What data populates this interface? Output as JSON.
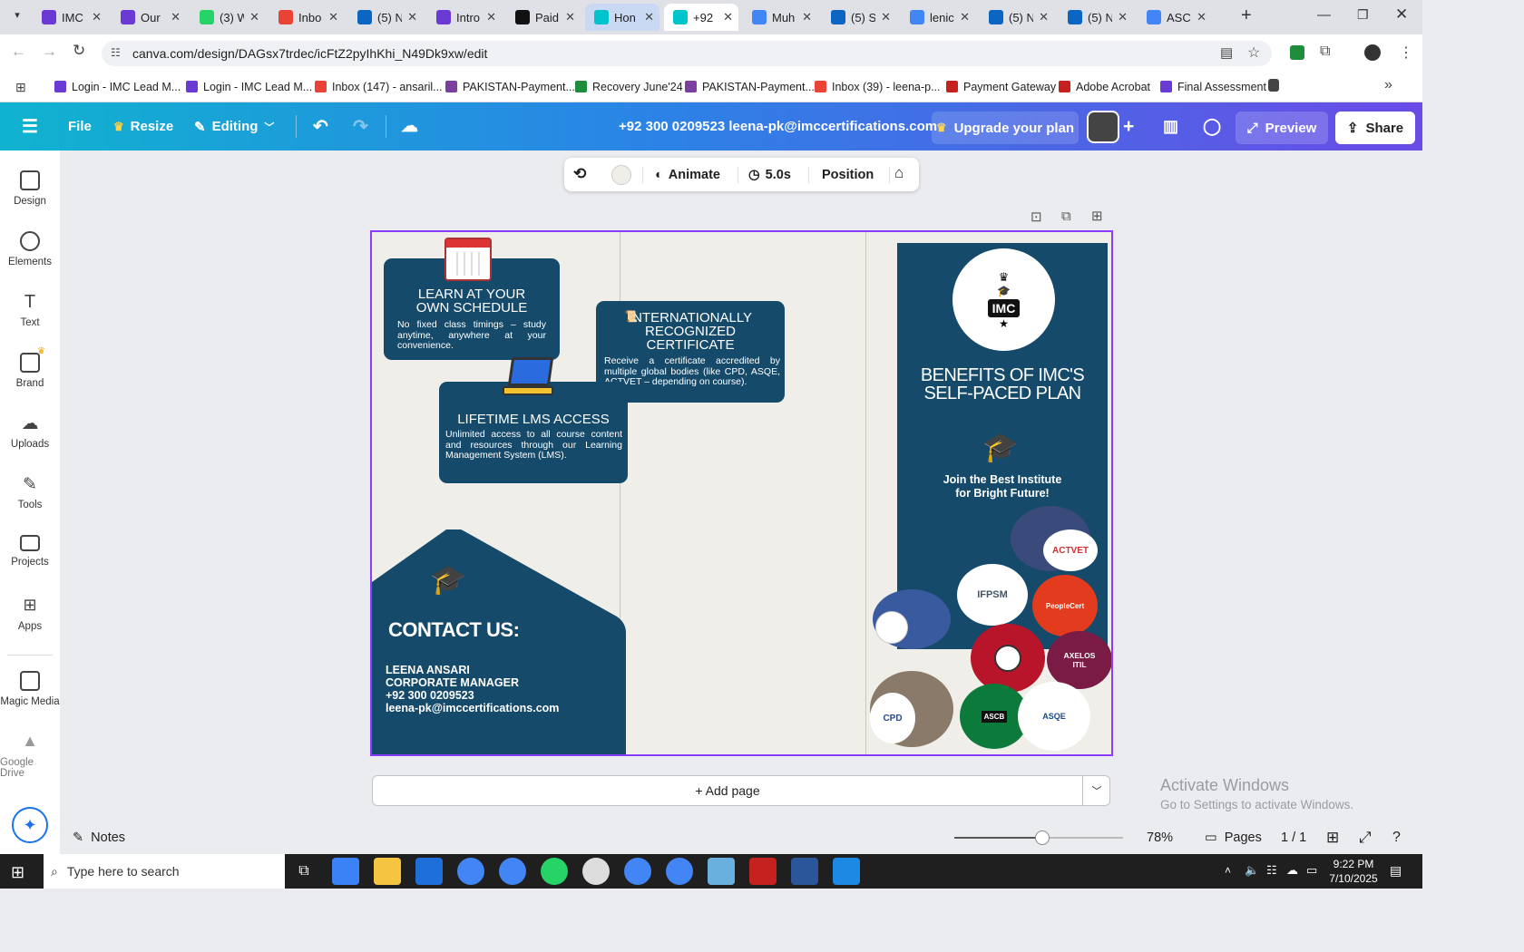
{
  "browser": {
    "tabs": [
      {
        "title": "IMC",
        "color": "#6b3ad4"
      },
      {
        "title": "Our",
        "color": "#6b3ad4"
      },
      {
        "title": "(3) W",
        "color": "#25d366"
      },
      {
        "title": "Inbo",
        "color": "#ea4335"
      },
      {
        "title": "(5) N",
        "color": "#0a66c2"
      },
      {
        "title": "Intro",
        "color": "#6b3ad4"
      },
      {
        "title": "Paid",
        "color": "#111111"
      },
      {
        "title": "Hon",
        "color": "#00c4cc"
      },
      {
        "title": "+92",
        "color": "#00c4cc"
      },
      {
        "title": "Muh",
        "color": "#4285f4"
      },
      {
        "title": "(5) S",
        "color": "#0a66c2"
      },
      {
        "title": "lenic",
        "color": "#4285f4"
      },
      {
        "title": "(5) N",
        "color": "#0a66c2"
      },
      {
        "title": "(5) N",
        "color": "#0a66c2"
      },
      {
        "title": "ASC",
        "color": "#4285f4"
      }
    ],
    "url": "canva.com/design/DAGsx7trdec/icFtZ2pyIhKhi_N49Dk9xw/edit",
    "bookmarks": [
      {
        "label": "Login - IMC Lead M...",
        "color": "#6b3ad4"
      },
      {
        "label": "Login - IMC Lead M...",
        "color": "#6b3ad4"
      },
      {
        "label": "Inbox (147) - ansaril...",
        "color": "#ea4335"
      },
      {
        "label": "PAKISTAN-Payment...",
        "color": "#7b3fa0"
      },
      {
        "label": "Recovery June'24",
        "color": "#1e8e3e"
      },
      {
        "label": "PAKISTAN-Payment...",
        "color": "#7b3fa0"
      },
      {
        "label": "Inbox (39) - leena-p...",
        "color": "#ea4335"
      },
      {
        "label": "Payment Gateway",
        "color": "#c5221f"
      },
      {
        "label": "Adobe Acrobat",
        "color": "#c5221f"
      },
      {
        "label": "Final Assessment",
        "color": "#6b3ad4"
      }
    ]
  },
  "header": {
    "file": "File",
    "resize": "Resize",
    "editing": "Editing",
    "title": "+92 300 0209523 leena-pk@imccertifications.com",
    "upgrade": "Upgrade your plan",
    "preview": "Preview",
    "share": "Share"
  },
  "sidebar": {
    "items": [
      "Design",
      "Elements",
      "Text",
      "Brand",
      "Uploads",
      "Tools",
      "Projects",
      "Apps",
      "Magic Media",
      "Google Drive"
    ]
  },
  "toolbar": {
    "animate": "Animate",
    "duration": "5.0s",
    "position": "Position"
  },
  "design": {
    "card1": {
      "title": "LEARN AT YOUR OWN SCHEDULE",
      "body": "No fixed class timings – study anytime, anywhere at your convenience."
    },
    "card2": {
      "title": "INTERNATIONALLY RECOGNIZED CERTIFICATE",
      "body": "Receive a certificate accredited by multiple global bodies (like CPD, ASQE, ACTVET – depending on course)."
    },
    "card3": {
      "title": "LIFETIME LMS ACCESS",
      "body": "Unlimited access to all course content and resources through our Learning Management System (LMS)."
    },
    "contact": {
      "title": "CONTACT US:",
      "name": "LEENA ANSARI",
      "role": "CORPORATE MANAGER",
      "phone": "+92 300 0209523",
      "email": "leena-pk@imccertifications.com"
    },
    "cover": {
      "logo_text": "IMC",
      "headline": "BENEFITS OF IMC'S SELF-PACED PLAN",
      "tagline": "Join the Best Institute for Bright Future!"
    },
    "badges": [
      "ACTVET",
      "IFPSM",
      "PeopleCert",
      "AXELOS",
      "ITIL",
      "CPD",
      "ASQE",
      "ASCB"
    ]
  },
  "editor": {
    "add_page": "+ Add page",
    "notes": "Notes",
    "zoom": "78%",
    "pages_label": "Pages",
    "pages_value": "1 / 1",
    "watermark_title": "Activate Windows",
    "watermark_sub": "Go to Settings to activate Windows."
  },
  "taskbar": {
    "search": "Type here to search",
    "time": "9:22 PM",
    "date": "7/10/2025"
  }
}
